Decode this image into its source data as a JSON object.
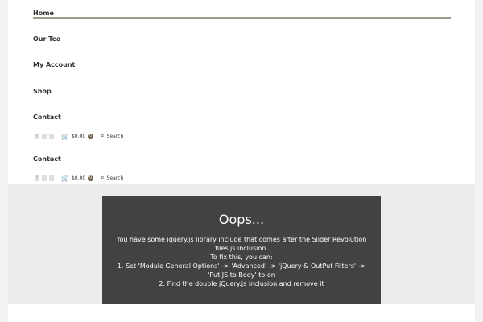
{
  "nav": {
    "items": [
      "Home",
      "Our Tea",
      "My Account",
      "Shop",
      "Contact"
    ]
  },
  "header_tools": {
    "cart_total": "$0.00",
    "cart_count": "0",
    "search_label": "Search",
    "social": [
      "f",
      "ig",
      "tw"
    ]
  },
  "sticky": {
    "item": "Contact"
  },
  "error": {
    "title": "Oops...",
    "lines": [
      "You have some jquery.js library include that comes after the Slider Revolution files js inclusion.",
      "To fix this, you can:",
      "1. Set 'Module General Options' -> 'Advanced' -> 'jQuery & OutPut Filters' -> 'Put JS to Body' to on",
      "2. Find the double jQuery.js inclusion and remove it"
    ]
  }
}
